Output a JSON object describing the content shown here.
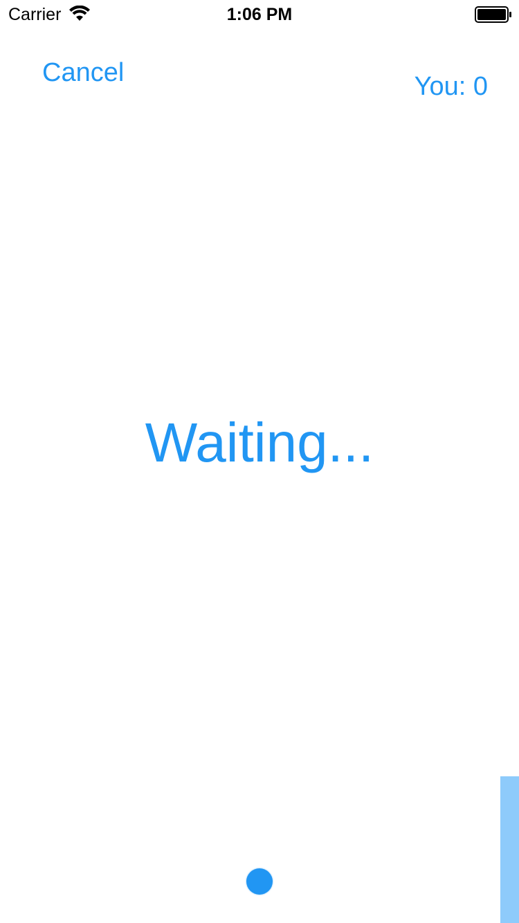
{
  "status_bar": {
    "carrier": "Carrier",
    "time": "1:06 PM",
    "icons": [
      "wifi-icon",
      "battery-icon"
    ]
  },
  "nav": {
    "cancel_label": "Cancel",
    "score_label": "You: 0"
  },
  "game": {
    "status_text": "Waiting..."
  },
  "colors": {
    "accent": "#2196f3",
    "paddle": "#8ecbfb",
    "background": "#ffffff"
  }
}
